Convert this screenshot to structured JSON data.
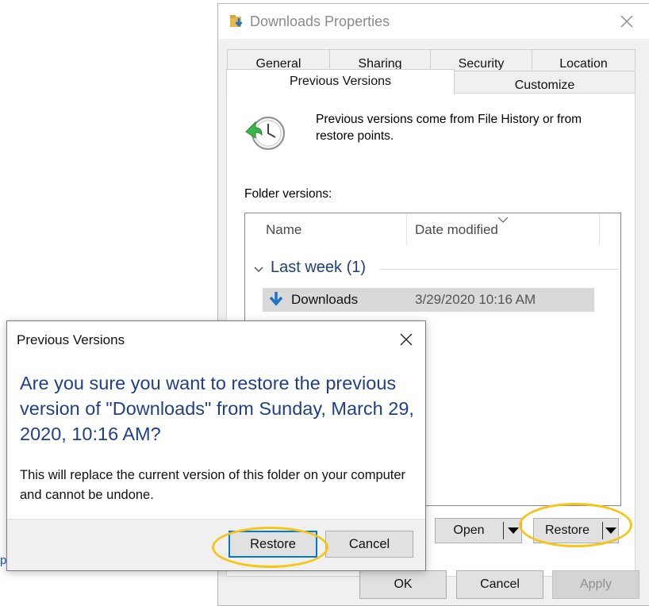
{
  "background": {
    "edge_text": "p"
  },
  "properties_window": {
    "title": "Downloads Properties",
    "tabs_row1": [
      "General",
      "Sharing",
      "Security",
      "Location"
    ],
    "tabs_row2": [
      "Previous Versions",
      "Customize"
    ],
    "active_tab": "Previous Versions",
    "description": "Previous versions come from File History or from restore points.",
    "folder_versions_label": "Folder versions:",
    "columns": [
      "Name",
      "Date modified"
    ],
    "group": {
      "label": "Last week (1)"
    },
    "items": [
      {
        "name": "Downloads",
        "date_modified": "3/29/2020 10:16 AM"
      }
    ],
    "open_button": "Open",
    "restore_button": "Restore",
    "footer_buttons": {
      "ok": "OK",
      "cancel": "Cancel",
      "apply": "Apply"
    }
  },
  "confirm_dialog": {
    "title": "Previous Versions",
    "heading": "Are you sure you want to restore the previous version of \"Downloads\" from Sunday, March 29, 2020, 10:16 AM?",
    "message": "This will replace the current version of this folder on your computer and cannot be undone.",
    "restore_button": "Restore",
    "cancel_button": "Cancel"
  },
  "colors": {
    "heading_blue": "#1f3f8c",
    "group_blue": "#1e3f7a",
    "focus_blue": "#0078d7",
    "highlight_ring": "#f5c518"
  },
  "icons": [
    "folder-download-icon",
    "close-icon",
    "restore-clock-icon",
    "chevron-down-icon",
    "sort-caret-icon",
    "download-arrow-icon",
    "dropdown-arrow-icon"
  ]
}
